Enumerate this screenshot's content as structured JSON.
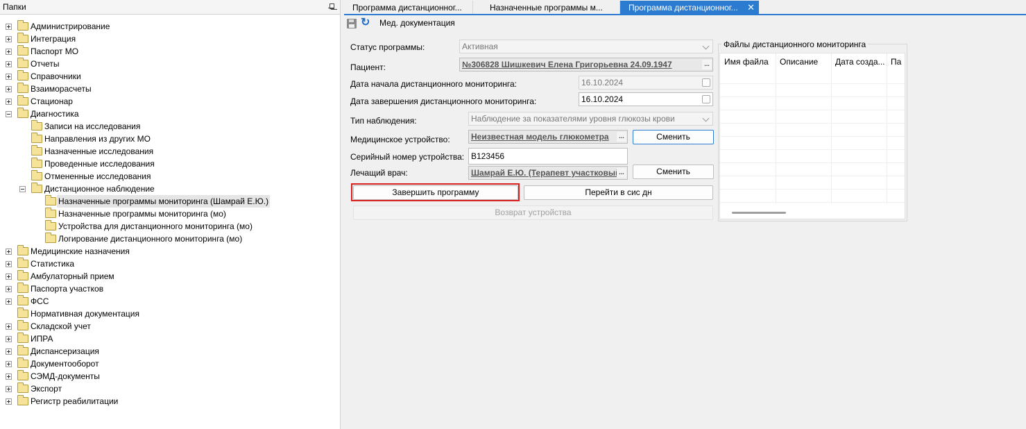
{
  "left_pane": {
    "title": "Папки",
    "tree": [
      {
        "label": "Администрирование",
        "level": 0,
        "expander": "plus",
        "selected": false
      },
      {
        "label": "Интеграция",
        "level": 0,
        "expander": "plus",
        "selected": false
      },
      {
        "label": "Паспорт МО",
        "level": 0,
        "expander": "plus",
        "selected": false
      },
      {
        "label": "Отчеты",
        "level": 0,
        "expander": "plus",
        "selected": false
      },
      {
        "label": "Справочники",
        "level": 0,
        "expander": "plus",
        "selected": false
      },
      {
        "label": "Взаиморасчеты",
        "level": 0,
        "expander": "plus",
        "selected": false
      },
      {
        "label": "Стационар",
        "level": 0,
        "expander": "plus",
        "selected": false
      },
      {
        "label": "Диагностика",
        "level": 0,
        "expander": "minus",
        "selected": false
      },
      {
        "label": "Записи на исследования",
        "level": 1,
        "expander": "none",
        "selected": false
      },
      {
        "label": "Направления из других МО",
        "level": 1,
        "expander": "none",
        "selected": false
      },
      {
        "label": "Назначенные исследования",
        "level": 1,
        "expander": "none",
        "selected": false
      },
      {
        "label": "Проведенные исследования",
        "level": 1,
        "expander": "none",
        "selected": false
      },
      {
        "label": "Отмененные исследования",
        "level": 1,
        "expander": "none",
        "selected": false
      },
      {
        "label": "Дистанционное наблюдение",
        "level": 1,
        "expander": "minus",
        "selected": false
      },
      {
        "label": "Назначенные программы мониторинга (Шамрай Е.Ю.)",
        "level": 2,
        "expander": "none",
        "selected": true
      },
      {
        "label": "Назначенные программы мониторинга (мо)",
        "level": 2,
        "expander": "none",
        "selected": false
      },
      {
        "label": "Устройства для дистанционного мониторинга (мо)",
        "level": 2,
        "expander": "none",
        "selected": false
      },
      {
        "label": "Логирование дистанционного мониторинга (мо)",
        "level": 2,
        "expander": "none",
        "selected": false
      },
      {
        "label": "Медицинские назначения",
        "level": 0,
        "expander": "plus",
        "selected": false
      },
      {
        "label": "Статистика",
        "level": 0,
        "expander": "plus",
        "selected": false
      },
      {
        "label": "Амбулаторный прием",
        "level": 0,
        "expander": "plus",
        "selected": false
      },
      {
        "label": "Паспорта участков",
        "level": 0,
        "expander": "plus",
        "selected": false
      },
      {
        "label": "ФСС",
        "level": 0,
        "expander": "plus",
        "selected": false
      },
      {
        "label": "Нормативная документация",
        "level": 0,
        "expander": "none",
        "selected": false
      },
      {
        "label": "Складской учет",
        "level": 0,
        "expander": "plus",
        "selected": false
      },
      {
        "label": "ИПРА",
        "level": 0,
        "expander": "plus",
        "selected": false
      },
      {
        "label": "Диспансеризация",
        "level": 0,
        "expander": "plus",
        "selected": false
      },
      {
        "label": "Документооборот",
        "level": 0,
        "expander": "plus",
        "selected": false
      },
      {
        "label": "СЭМД-документы",
        "level": 0,
        "expander": "plus",
        "selected": false
      },
      {
        "label": "Экспорт",
        "level": 0,
        "expander": "plus",
        "selected": false
      },
      {
        "label": "Регистр реабилитации",
        "level": 0,
        "expander": "plus",
        "selected": false
      }
    ]
  },
  "tabs": [
    {
      "label": "Программа дистанционног...",
      "active": false
    },
    {
      "label": "Назначенные программы м...",
      "active": false
    },
    {
      "label": "Программа дистанционног...",
      "active": true,
      "close": "✕"
    }
  ],
  "toolbar": {
    "save_icon": "save-icon",
    "refresh_icon": "refresh-icon",
    "refresh_glyph": "↻",
    "med_docs_label": "Мед. документация"
  },
  "form": {
    "status_label": "Статус программы:",
    "status_value": "Активная",
    "patient_label": "Пациент:",
    "patient_value": "№306828 Шишкевич Елена Григорьевна 24.09.1947",
    "start_label": "Дата начала дистанционного мониторинга:",
    "start_value": "16.10.2024",
    "end_label": "Дата завершения дистанционного мониторинга:",
    "end_value": "16.10.2024",
    "observation_label": "Тип наблюдения:",
    "observation_value": "Наблюдение за показателями уровня глюкозы крови",
    "device_label": "Медицинское устройство:",
    "device_value": "Неизвестная модель глюкометра",
    "serial_label": "Серийный номер устройства:",
    "serial_value": "B123456",
    "doctor_label": "Лечащий врач:",
    "doctor_value": "Шамрай Е.Ю. (Терапевт участковый",
    "ellipsis": "...",
    "change_device_button": "Сменить",
    "change_doctor_button": "Сменить",
    "finish_button": "Завершить программу",
    "goto_button": "Перейти в сис дн",
    "return_button": "Возврат устройства"
  },
  "files": {
    "title": "Файлы дистанционного мониторинга",
    "columns": [
      "Имя файла",
      "Описание",
      "Дата созда...",
      "Па"
    ]
  },
  "colors": {
    "accent": "#2b7bd0",
    "highlight": "#d9201c",
    "folder": "#f6e39a"
  }
}
